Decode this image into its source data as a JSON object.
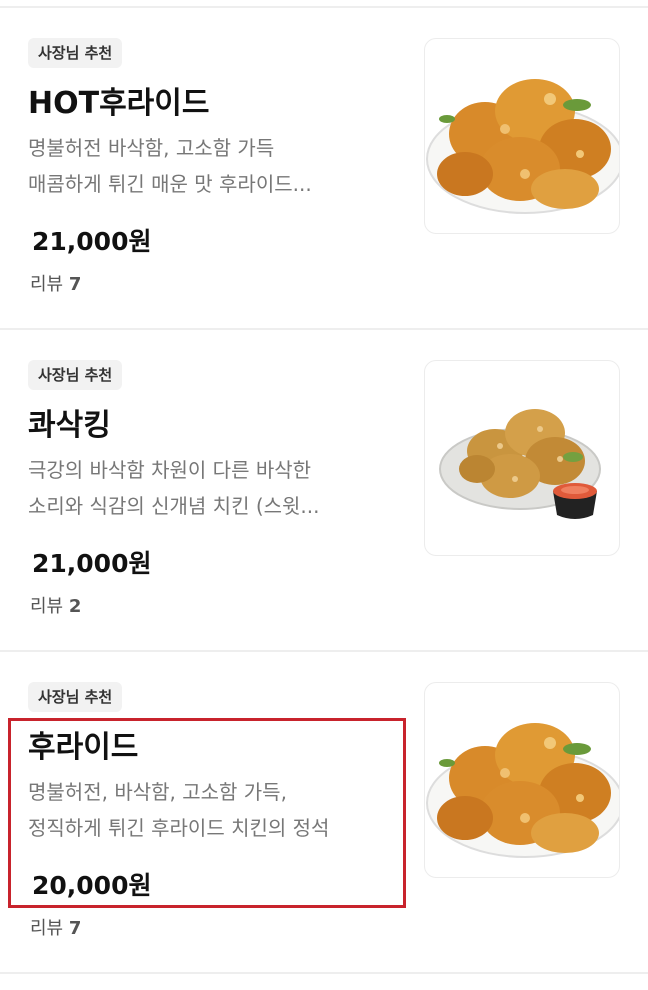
{
  "menu": {
    "items": [
      {
        "badge": "사장님 추천",
        "name": "HOT후라이드",
        "desc_line1": "명불허전 바삭함, 고소함 가득",
        "desc_line2": "매콤하게 튀긴 매운 맛 후라이드...",
        "price": "21,000원",
        "review_label": "리뷰",
        "review_count": "7",
        "image_icon": "fried-chicken-plate"
      },
      {
        "badge": "사장님 추천",
        "name": "콰삭킹",
        "desc_line1": "극강의 바삭함 차원이 다른 바삭한",
        "desc_line2": "소리와 식감의 신개념 치킨 (스윗...",
        "price": "21,000원",
        "review_label": "리뷰",
        "review_count": "2",
        "image_icon": "crispy-chicken-with-sauce"
      },
      {
        "badge": "사장님 추천",
        "name": "후라이드",
        "desc_line1": "명불허전, 바삭함, 고소함 가득,",
        "desc_line2": "정직하게 튀긴 후라이드 치킨의 정석",
        "price": "20,000원",
        "review_label": "리뷰",
        "review_count": "7",
        "image_icon": "fried-chicken-plate"
      }
    ]
  },
  "colors": {
    "highlight_border": "#c8232c",
    "badge_bg": "#f2f2f2",
    "desc_text": "#777777"
  }
}
